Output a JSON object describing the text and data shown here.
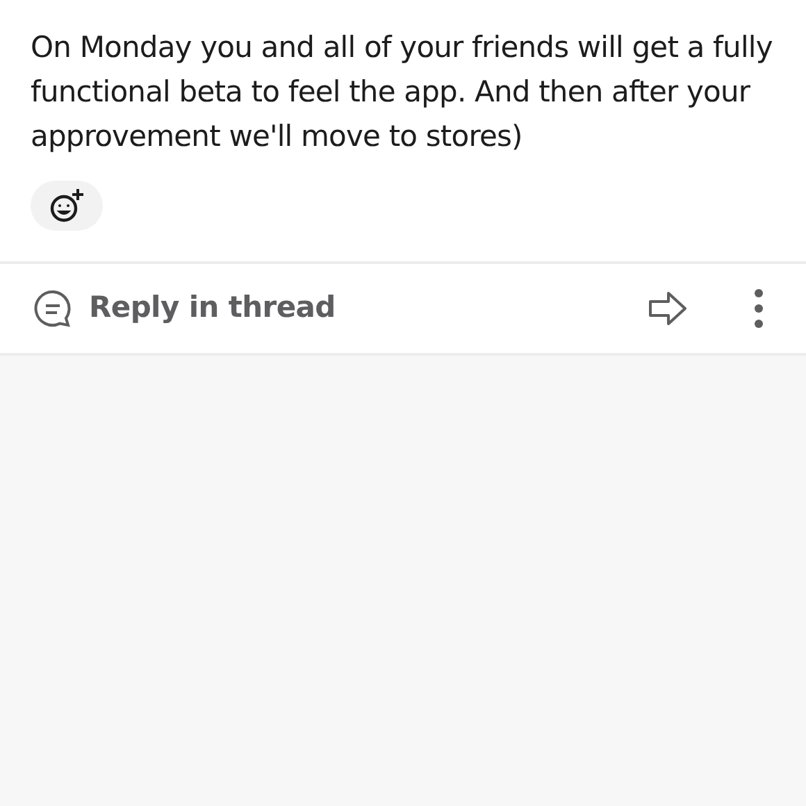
{
  "message": {
    "text": "On Monday you and all of your friends will get a fully functional beta to feel the app. And then after your approvement we'll move to stores)"
  },
  "actions": {
    "reply_label": "Reply in thread"
  }
}
